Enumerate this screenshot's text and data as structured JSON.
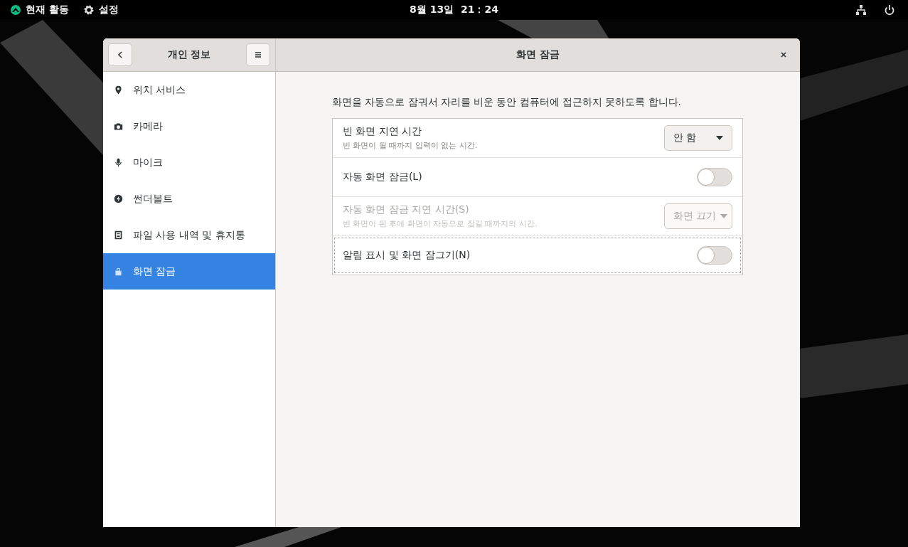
{
  "top_bar": {
    "activities": "현재 활동",
    "app_menu": "설정",
    "clock": "8월 13일  21：24"
  },
  "window": {
    "sidebar_title": "개인 정보",
    "title": "화면 잠금"
  },
  "sidebar": {
    "items": [
      {
        "label": "위치 서비스",
        "selected": false
      },
      {
        "label": "카메라",
        "selected": false
      },
      {
        "label": "마이크",
        "selected": false
      },
      {
        "label": "썬더볼트",
        "selected": false
      },
      {
        "label": "파일 사용 내역 및 휴지통",
        "selected": false
      },
      {
        "label": "화면 잠금",
        "selected": true
      }
    ]
  },
  "description": "화면을 자동으로 잠궈서 자리를 비운 동안 컴퓨터에 접근하지 못하도록 합니다.",
  "settings": [
    {
      "kind": "combo",
      "title": "빈 화면 지연 시간",
      "subtitle": "빈 화면이 될 때까지 입력이 없는 시간.",
      "value": "안 함",
      "disabled": false,
      "focused": false
    },
    {
      "kind": "switch",
      "title": "자동 화면 잠금(L)",
      "on": false,
      "disabled": false,
      "focused": false
    },
    {
      "kind": "combo",
      "title": "자동 화면 잠금 지연 시간(S)",
      "subtitle": "빈 화면이 된 후에 화면이 자동으로 잠길 때까지의 시간.",
      "value": "화면 끄기",
      "disabled": true,
      "focused": false
    },
    {
      "kind": "switch",
      "title": "알림 표시 및 화면 잠그기(N)",
      "on": false,
      "disabled": false,
      "focused": true
    }
  ]
}
